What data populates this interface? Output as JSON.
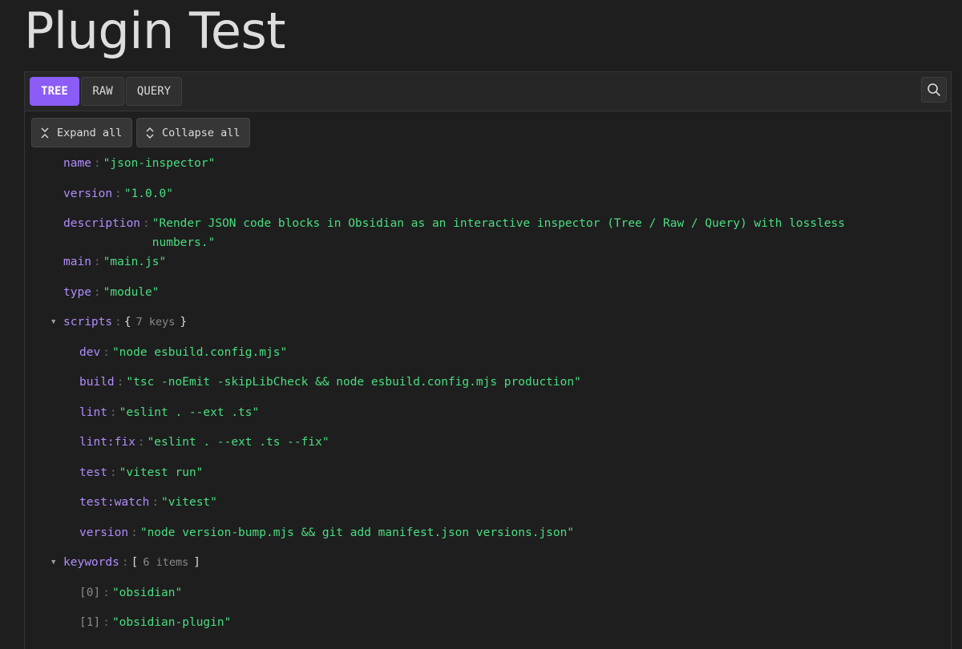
{
  "page": {
    "title": "Plugin Test"
  },
  "tabs": {
    "tree": "TREE",
    "raw": "RAW",
    "query": "QUERY"
  },
  "toolbar": {
    "expand_all": "Expand all",
    "collapse_all": "Collapse all"
  },
  "icons": {
    "search": "search-icon",
    "expand": "expand-icon",
    "collapse": "collapse-icon",
    "caret": "caret-down-icon"
  },
  "colors": {
    "accent": "#8b5cf6",
    "key": "#b18cff",
    "string": "#4ade80"
  },
  "tree": {
    "name": {
      "key": "name",
      "value": "\"json-inspector\""
    },
    "version": {
      "key": "version",
      "value": "\"1.0.0\""
    },
    "description": {
      "key": "description",
      "value": "\"Render JSON code blocks in Obsidian as an interactive inspector (Tree / Raw / Query) with lossless numbers.\""
    },
    "main": {
      "key": "main",
      "value": "\"main.js\""
    },
    "type": {
      "key": "type",
      "value": "\"module\""
    },
    "scripts": {
      "key": "scripts",
      "open": "{",
      "close": "}",
      "summary": "7 keys",
      "items": [
        {
          "key": "dev",
          "value": "\"node esbuild.config.mjs\""
        },
        {
          "key": "build",
          "value": "\"tsc -noEmit -skipLibCheck && node esbuild.config.mjs production\""
        },
        {
          "key": "lint",
          "value": "\"eslint . --ext .ts\""
        },
        {
          "key": "lint:fix",
          "value": "\"eslint . --ext .ts --fix\""
        },
        {
          "key": "test",
          "value": "\"vitest run\""
        },
        {
          "key": "test:watch",
          "value": "\"vitest\""
        },
        {
          "key": "version",
          "value": "\"node version-bump.mjs && git add manifest.json versions.json\""
        }
      ]
    },
    "keywords": {
      "key": "keywords",
      "open": "[",
      "close": "]",
      "summary": "6 items",
      "items": [
        {
          "key": "[0]",
          "value": "\"obsidian\""
        },
        {
          "key": "[1]",
          "value": "\"obsidian-plugin\""
        }
      ]
    }
  }
}
